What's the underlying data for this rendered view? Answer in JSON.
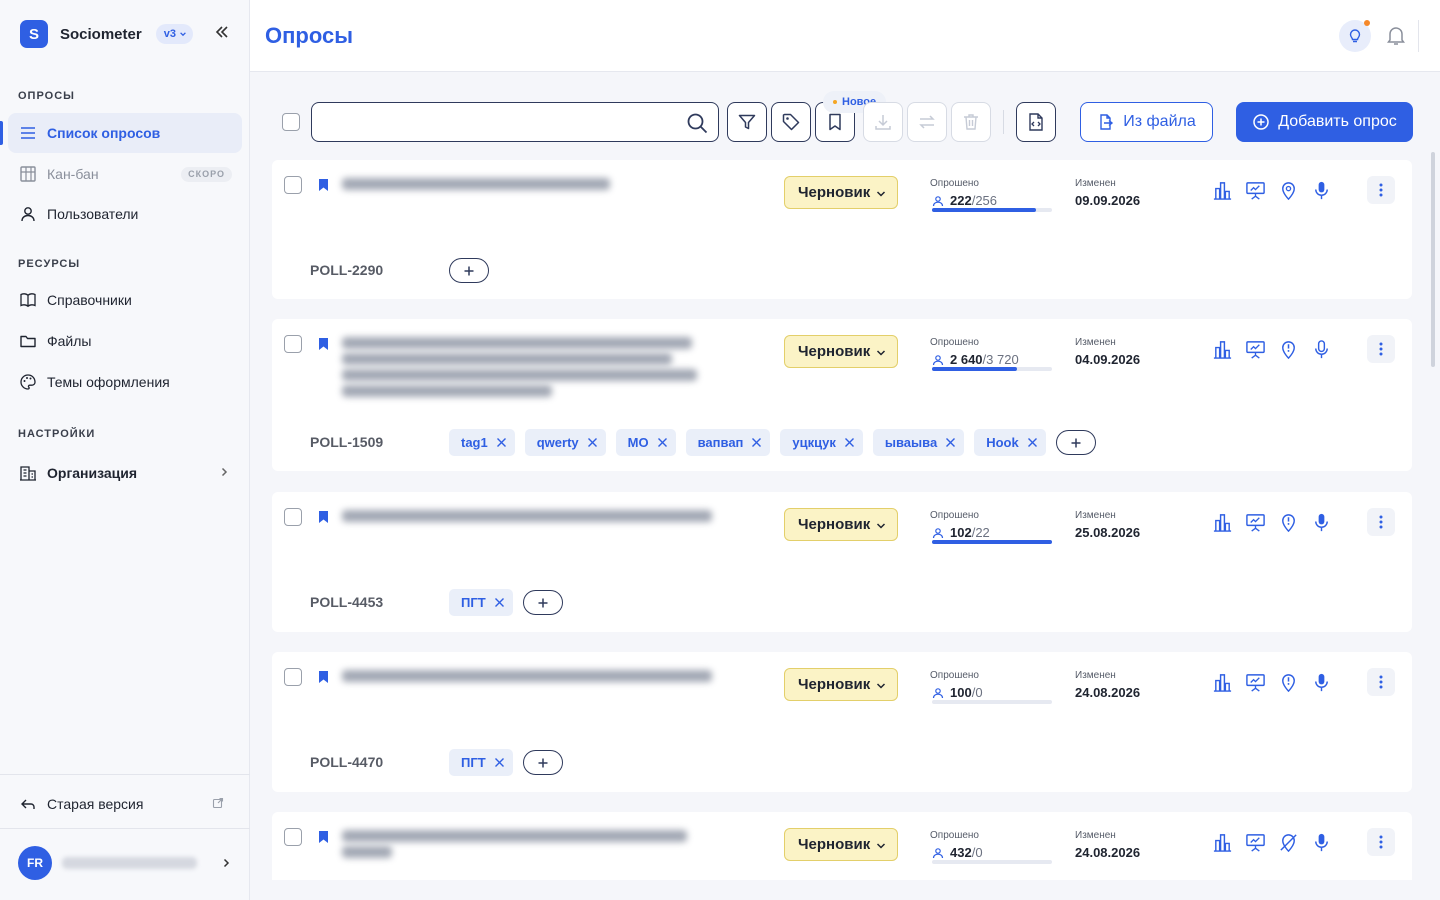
{
  "app": {
    "name": "Sociometer",
    "logo_letter": "S",
    "version": "v3"
  },
  "sidebar": {
    "sections": [
      {
        "title": "ОПРОСЫ"
      },
      {
        "title": "РЕСУРСЫ"
      },
      {
        "title": "НАСТРОЙКИ"
      }
    ],
    "items": [
      {
        "label": "Список опросов",
        "icon": "list-icon",
        "active": true
      },
      {
        "label": "Кан-бан",
        "icon": "kanban-icon",
        "badge": "СКОРО"
      },
      {
        "label": "Пользователи",
        "icon": "user-icon"
      },
      {
        "label": "Справочники",
        "icon": "book-icon"
      },
      {
        "label": "Файлы",
        "icon": "folder-icon"
      },
      {
        "label": "Темы оформления",
        "icon": "palette-icon"
      },
      {
        "label": "Организация",
        "icon": "building-icon"
      }
    ],
    "old_version": "Старая версия",
    "user": {
      "initials": "FR"
    }
  },
  "header": {
    "title": "Опросы"
  },
  "toolbar": {
    "search_placeholder": "",
    "new_badge": "Новое",
    "from_file": "Из файла",
    "add_poll": "Добавить опрос"
  },
  "labels": {
    "surveyed": "Опрошено",
    "changed": "Изменен"
  },
  "colors": {
    "accent": "#2f5fe3",
    "status_bg": "#fbf3c6",
    "status_border": "#e3cf6a"
  },
  "polls": [
    {
      "id": "POLL-2290",
      "status": "Черновик",
      "done": "222",
      "total": "256",
      "progress": 0.87,
      "date": "09.09.2026",
      "tags": [],
      "geo_icon": "map-pin-icon"
    },
    {
      "id": "POLL-1509",
      "status": "Черновик",
      "done": "2 640",
      "total": "3 720",
      "progress": 0.71,
      "date": "04.09.2026",
      "tags": [
        "tag1",
        "qwerty",
        "МО",
        "вапвап",
        "уцкцук",
        "ываыва",
        "Hook"
      ],
      "geo_icon": "map-pin-alert-icon"
    },
    {
      "id": "POLL-4453",
      "status": "Черновик",
      "done": "102",
      "total": "22",
      "progress": 1.0,
      "date": "25.08.2026",
      "tags": [
        "ПГТ"
      ],
      "geo_icon": "map-pin-alert-icon"
    },
    {
      "id": "POLL-4470",
      "status": "Черновик",
      "done": "100",
      "total": "0",
      "progress": 0.0,
      "date": "24.08.2026",
      "tags": [
        "ПГТ"
      ],
      "geo_icon": "map-pin-alert-icon"
    },
    {
      "id": "",
      "status": "Черновик",
      "done": "432",
      "total": "0",
      "progress": 0.0,
      "date": "24.08.2026",
      "tags": [],
      "geo_icon": "map-pin-off-icon"
    }
  ]
}
